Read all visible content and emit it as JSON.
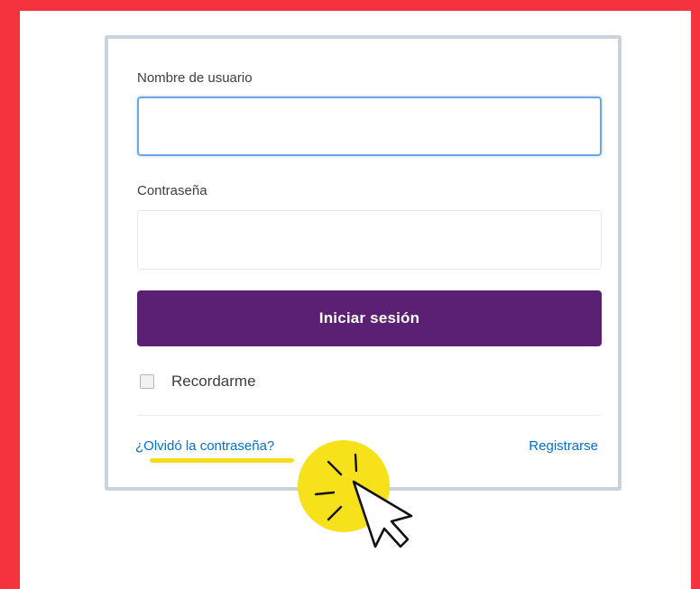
{
  "login_form": {
    "username_label": "Nombre de usuario",
    "username_value": "",
    "password_label": "Contraseña",
    "password_value": "",
    "login_button": "Iniciar sesión",
    "remember_label": "Recordarme",
    "remember_checked": false,
    "forgot_link": "¿Olvidó la contraseña?",
    "register_link": "Registrarse"
  },
  "colors": {
    "frame": "#f5333f",
    "button": "#5b2072",
    "link": "#0070d2",
    "highlight": "#f7e11a",
    "focus_border": "#6ba7e2"
  },
  "icons": [
    "cursor-arrow-icon",
    "click-burst-icon"
  ]
}
